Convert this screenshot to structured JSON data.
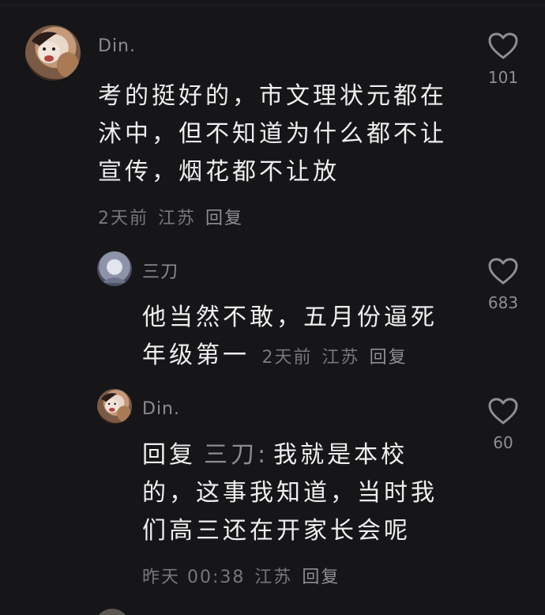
{
  "comments": [
    {
      "username": "Din.",
      "text_lines": [
        "考的挺好的，市文理状元都在",
        "沭中，但不知道为什么都不让",
        "宣传，烟花都不让放"
      ],
      "meta": {
        "time": "2天前",
        "location": "江苏",
        "reply": "回复"
      },
      "likes": "101"
    },
    {
      "username": "三刀",
      "text_lines": [
        "他当然不敢，五月份逼死",
        "年级第一"
      ],
      "meta": {
        "time": "2天前",
        "location": "江苏",
        "reply": "回复"
      },
      "likes": "683"
    },
    {
      "username": "Din.",
      "reply_prefix": "回复",
      "reply_to": "三刀:",
      "text_lines": [
        "我就是本校",
        "的，这事我知道，当时我",
        "们高三还在开家长会呢"
      ],
      "meta": {
        "time": "昨天 00:38",
        "location": "江苏",
        "reply": "回复"
      },
      "likes": "60"
    }
  ],
  "icons": {
    "like": "heart-outline-icon"
  },
  "colors": {
    "background": "#161618",
    "username": "#8c8c90",
    "meta": "#77777c",
    "text": "#efeff0"
  }
}
